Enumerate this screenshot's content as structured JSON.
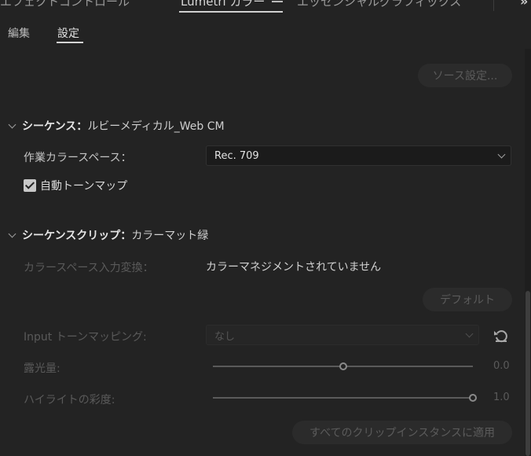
{
  "panel_tabs": [
    {
      "label": "エフェクトコントロール",
      "active": false
    },
    {
      "label": "Lumetri カラー",
      "active": true
    },
    {
      "label": "エッセンシャルグラフィックス",
      "active": false
    }
  ],
  "sub_tabs": [
    {
      "label": "編集",
      "active": false
    },
    {
      "label": "設定",
      "active": true
    }
  ],
  "source_settings_button": "ソース設定...",
  "sequence": {
    "heading": "シーケンス：",
    "name": "ルビーメディカル_Web CM",
    "working_color_space_label": "作業カラースペース：",
    "working_color_space_value": "Rec. 709",
    "auto_tonemap_label": "自動トーンマップ",
    "auto_tonemap_checked": true
  },
  "sequence_clip": {
    "heading": "シーケンスクリップ：",
    "name": "カラーマット緑",
    "input_conversion_label": "カラースペース入力変換：",
    "input_conversion_status": "カラーマネジメントされていません",
    "default_button": "デフォルト",
    "input_tonemapping_label": "Input トーンマッピング:",
    "input_tonemapping_value": "なし",
    "exposure_label": "露光量:",
    "exposure_value": "0.0",
    "exposure_fraction": 0.5,
    "highlight_saturation_label": "ハイライトの彩度:",
    "highlight_saturation_value": "1.0",
    "highlight_saturation_fraction": 1.0,
    "apply_all_button": "すべてのクリップインスタンスに適用"
  },
  "colors": {
    "background": "#232323",
    "text_primary": "#d0d0d0",
    "text_disabled": "#5a5a5a"
  }
}
